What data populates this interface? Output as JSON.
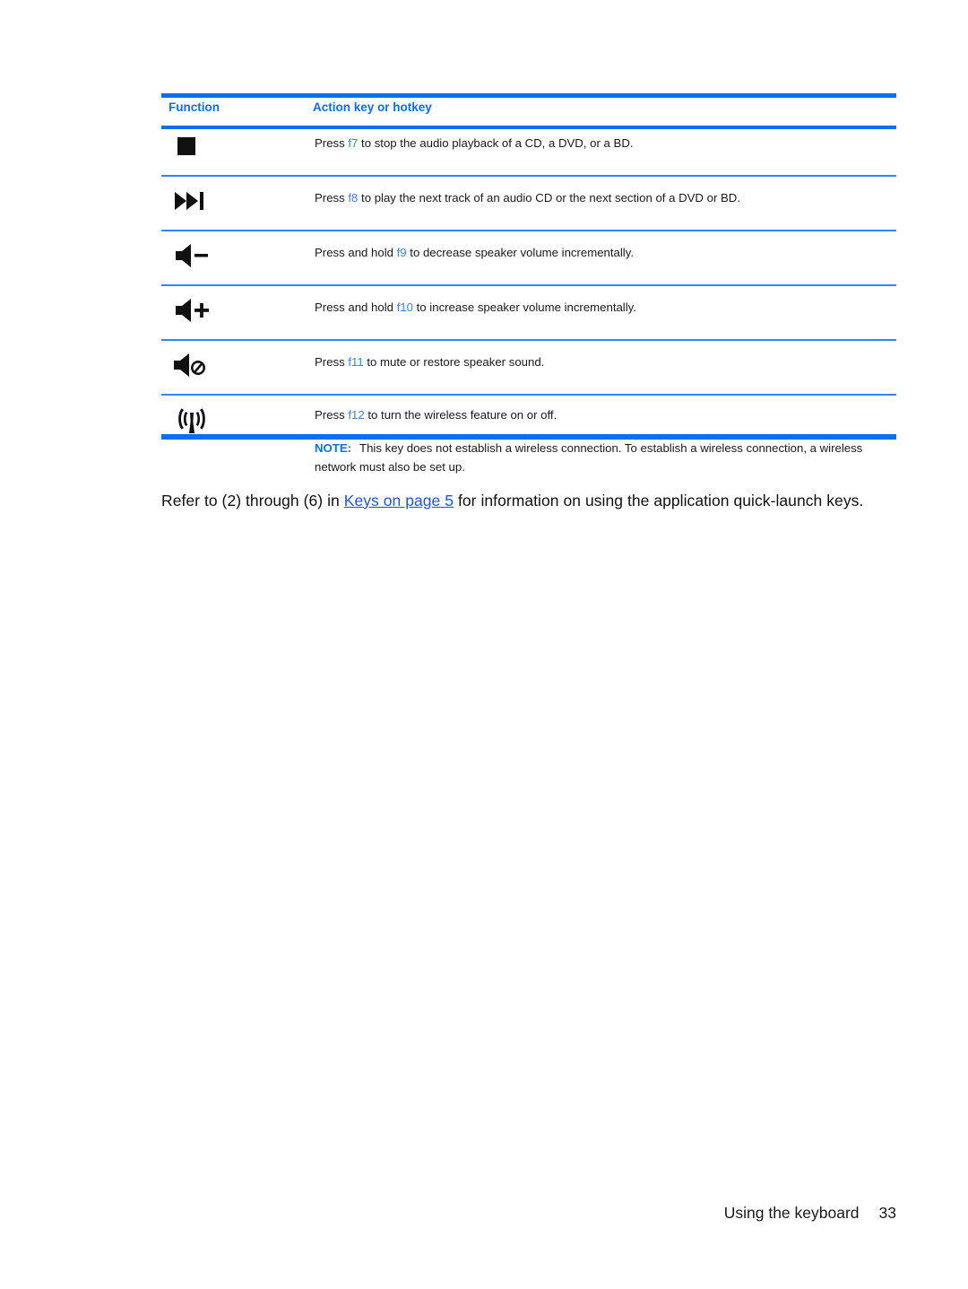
{
  "document": {
    "table": {
      "headers": {
        "function": "Function",
        "action": "Action key or hotkey"
      },
      "rows": [
        {
          "icon": "stop-icon",
          "prefix": "Press ",
          "fkey": "f7",
          "suffix": " to stop the audio playback of a CD, a DVD, or a BD."
        },
        {
          "icon": "next-track-icon",
          "prefix": "Press ",
          "fkey": "f8",
          "suffix": " to play the next track of an audio CD or the next section of a DVD or BD."
        },
        {
          "icon": "volume-down-icon",
          "prefix": "Press and hold ",
          "fkey": "f9",
          "suffix": " to decrease speaker volume incrementally."
        },
        {
          "icon": "volume-up-icon",
          "prefix": "Press and hold ",
          "fkey": "f10",
          "suffix": " to increase speaker volume incrementally."
        },
        {
          "icon": "mute-icon",
          "prefix": "Press ",
          "fkey": "f11",
          "suffix": " to mute or restore speaker sound."
        },
        {
          "icon": "wireless-icon",
          "prefix": "Press ",
          "fkey": "f12",
          "suffix": " to turn the wireless feature on or off.",
          "note_label": "NOTE:",
          "note_text": "This key does not establish a wireless connection. To establish a wireless connection, a wireless network must also be set up."
        }
      ]
    },
    "body_paragraph": {
      "before_link": "Refer to (2) through (6) in ",
      "link_text": "Keys on page 5",
      "after_link": " for information on using the application quick-launch keys."
    },
    "footer": {
      "section_title": "Using the keyboard",
      "page_number": "33"
    },
    "colors": {
      "accent_blue": "#0b6ff5",
      "rule_blue": "#2f86ff",
      "link_blue": "#1a56f0",
      "text_black": "#1a1a1a"
    }
  }
}
